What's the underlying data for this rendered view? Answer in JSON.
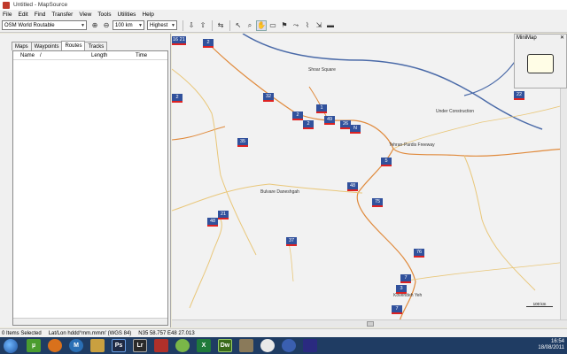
{
  "window": {
    "title": "Untitled - MapSource"
  },
  "menu": [
    "File",
    "Edit",
    "Find",
    "Transfer",
    "View",
    "Tools",
    "Utilities",
    "Help"
  ],
  "toolbar": {
    "map_select": "OSM World Routable",
    "zoom_select": "100 km",
    "detail_select": "Highest"
  },
  "panel": {
    "tabs": [
      "Maps",
      "Waypoints",
      "Routes",
      "Tracks"
    ],
    "active_tab": "Routes",
    "columns": [
      "Name",
      "/",
      "Length",
      "Time"
    ]
  },
  "map": {
    "labels": {
      "shoar": "Shoar Square",
      "under_construction": "Under Construction",
      "freeway": "Tehran-Pardis Freeway",
      "daneshgah": "Bulvare Daneshgah",
      "kovendeh": "Kovendeh Yeh"
    },
    "shields": [
      "16 21",
      "2",
      "22",
      "32",
      "2",
      "1",
      "49",
      "2",
      "26",
      "N",
      "35",
      "5",
      "48",
      "75",
      "21",
      "48",
      "37",
      "76",
      "7",
      "3",
      "7",
      "2"
    ],
    "minimap_title": "MiniMap",
    "scale_label": "100 km",
    "colors": {
      "major_road": "#e08a3c",
      "secondary_road": "#e9c77a",
      "highway": "#4a6aa8",
      "background": "#f2f2f2"
    }
  },
  "status": {
    "selected": "0 Items Selected",
    "format": "Lat/Lon hddd°mm.mmm' (WGS 84)",
    "coords": "N35 58.757 E48 27.013"
  },
  "taskbar": {
    "icons": [
      "windows-start",
      "utorrent",
      "firefox",
      "mapsource-m",
      "folder",
      "photoshop",
      "lightroom",
      "filezilla",
      "spotify",
      "excel",
      "dreamweaver",
      "gimp",
      "pidgin",
      "firefox-2",
      "mapsource"
    ],
    "time": "16:54",
    "date": "18/08/2011"
  }
}
